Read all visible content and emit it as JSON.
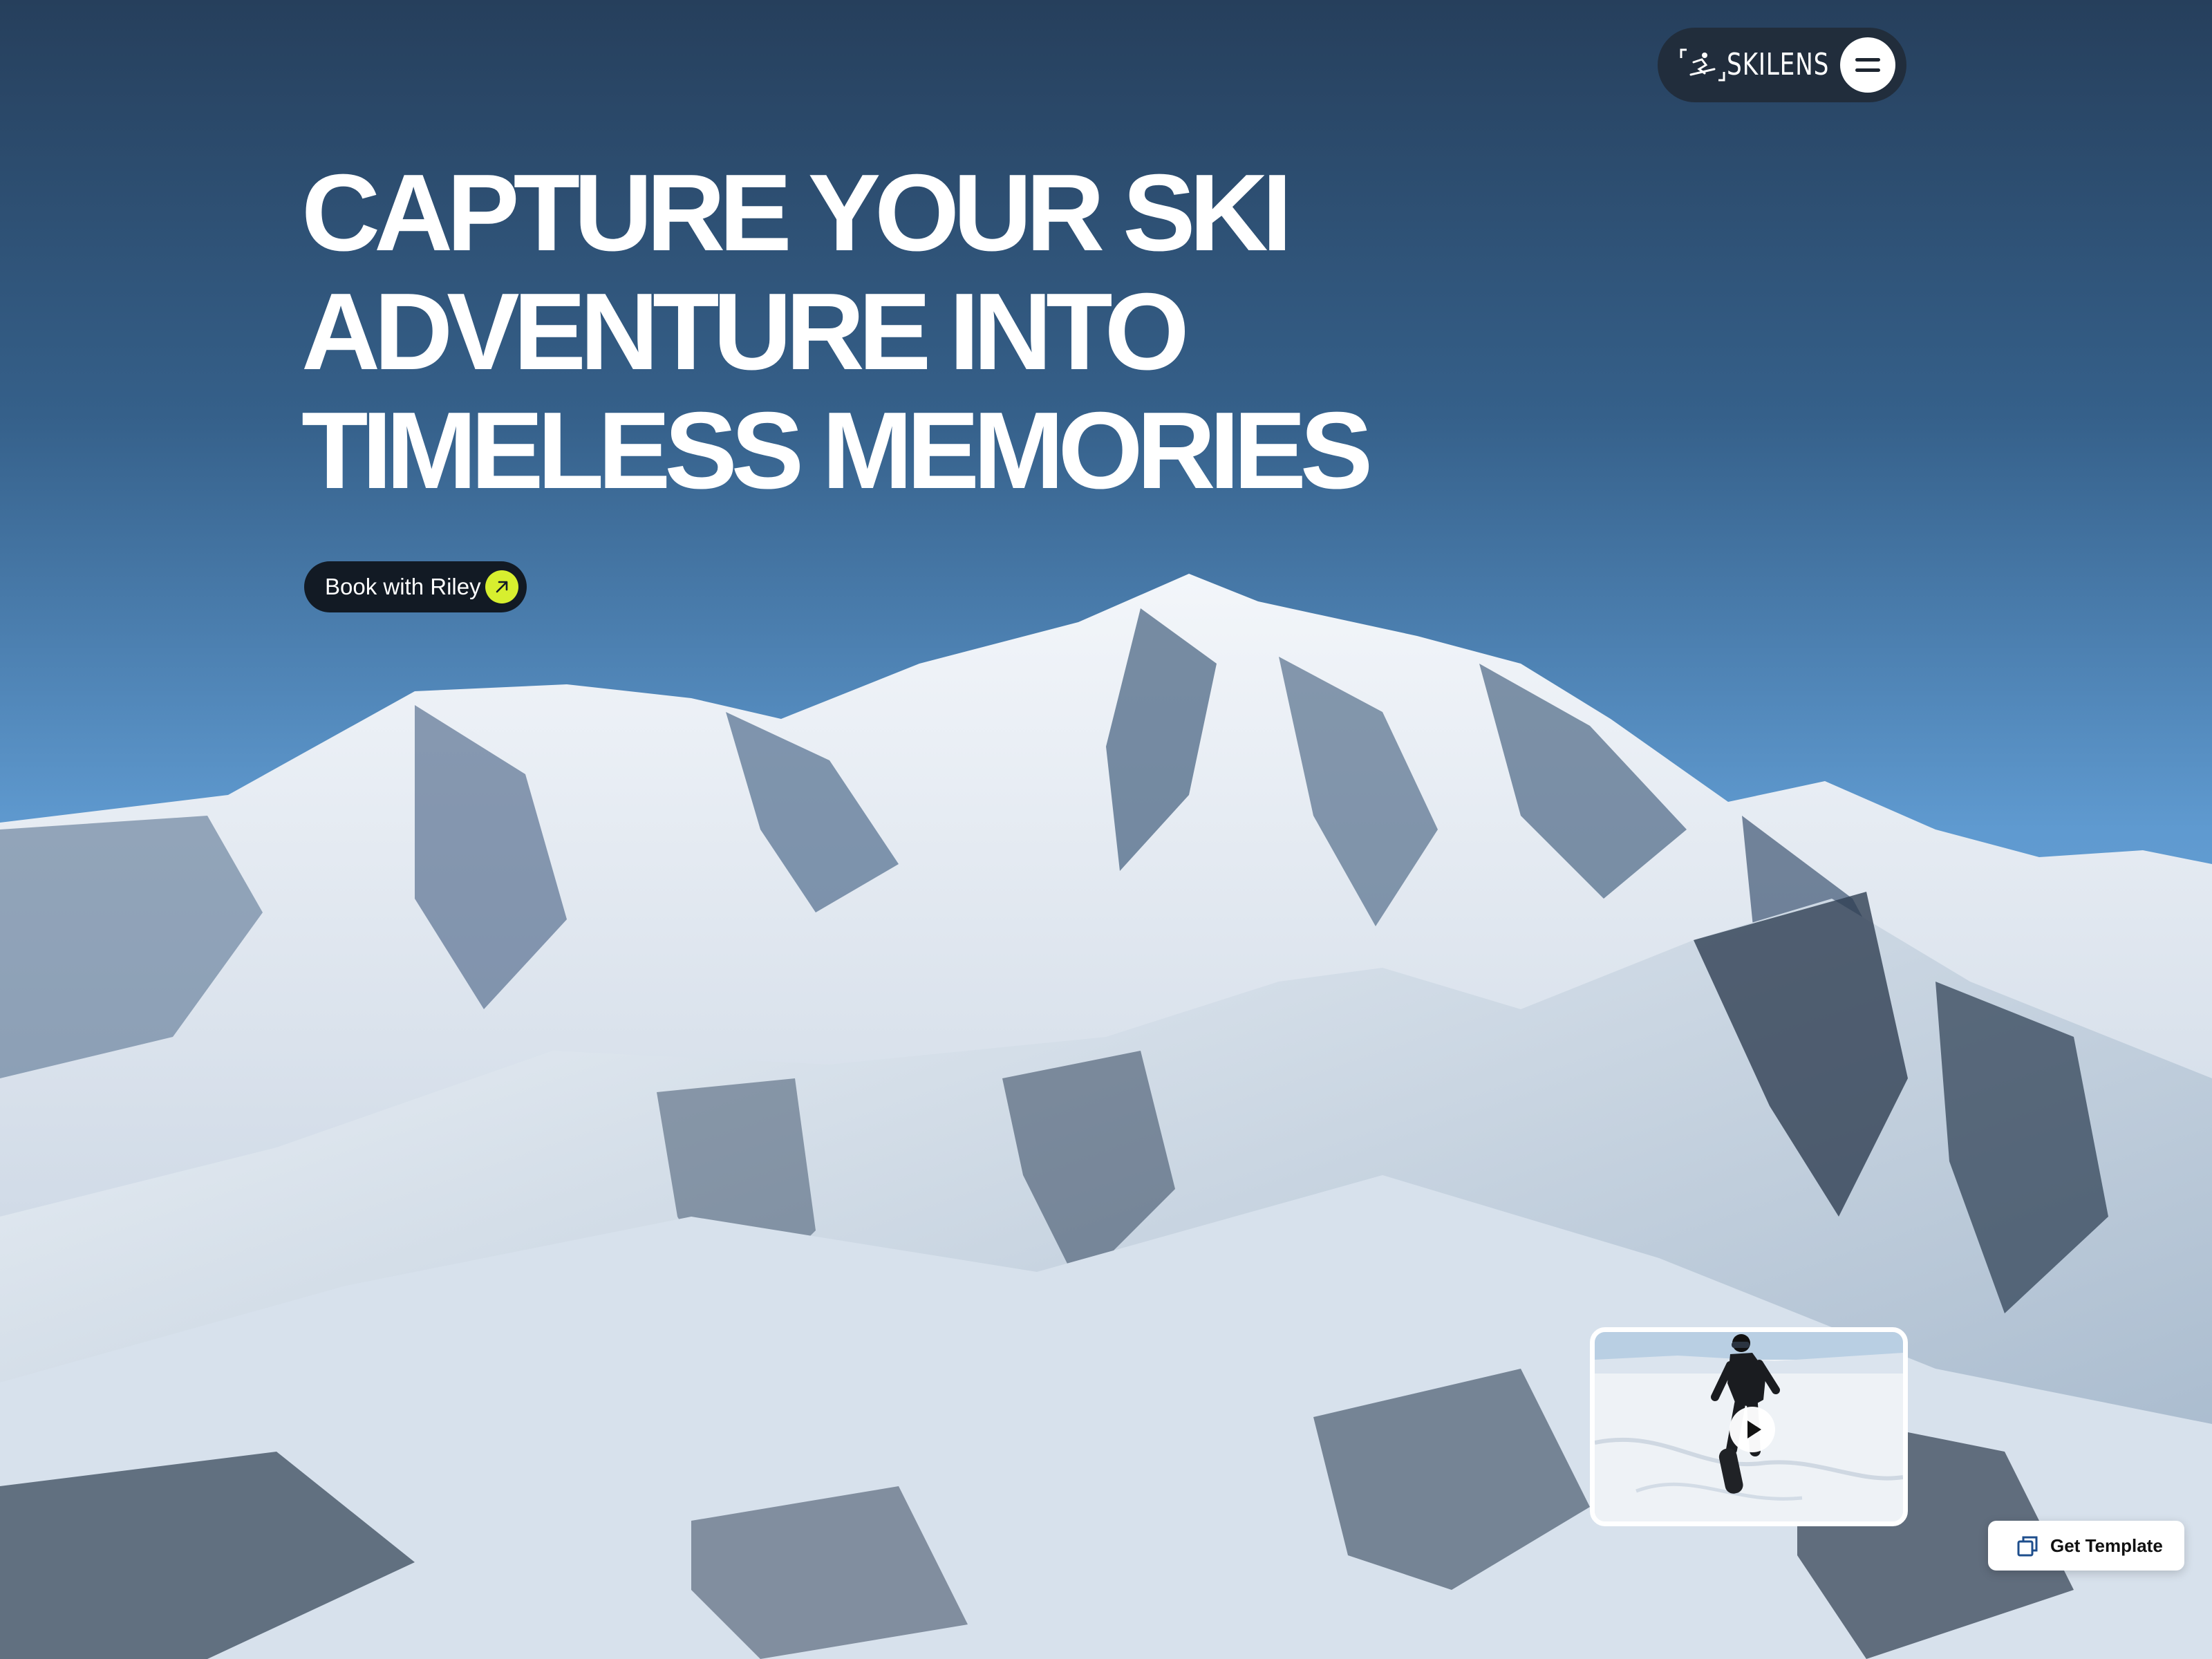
{
  "brand": {
    "name": "SKILENS",
    "logo_icon": "skier-icon"
  },
  "nav": {
    "menu_icon": "hamburger-icon"
  },
  "hero": {
    "headline_lines": [
      "CAPTURE YOUR SKI",
      "ADVENTURE INTO",
      "TIMELESS MEMORIES"
    ],
    "cta_label": "Book with Riley",
    "cta_icon": "arrow-up-right-icon",
    "background": "snowy-mountain-range-photo"
  },
  "video": {
    "icon": "play-icon",
    "thumbnail": "snowboarder-photo"
  },
  "template_button": {
    "label": "Get Template",
    "icon": "copy-icon"
  },
  "colors": {
    "sky_top": "#263f5c",
    "sky_bottom": "#5f9ad0",
    "accent": "#d7ef2f",
    "dark": "#121a24",
    "white": "#ffffff"
  }
}
